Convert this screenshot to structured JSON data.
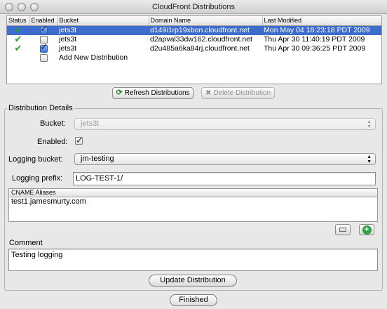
{
  "window": {
    "title": "CloudFront Distributions"
  },
  "table": {
    "columns": [
      "Status",
      "Enabled",
      "Bucket",
      "Domain Name",
      "Last Modified"
    ],
    "rows": [
      {
        "bucket": "jets3t",
        "domain": "d149i1rp19xbon.cloudfront.net",
        "modified": "Mon May 04 18:23:18 PDT 2009",
        "enabled": true,
        "status": "deployed-icon",
        "selected": true
      },
      {
        "bucket": "jets3t",
        "domain": "d2apval33dw162.cloudfront.net",
        "modified": "Thu Apr 30 11:40:19 PDT 2009",
        "enabled": false,
        "status": "deployed-icon",
        "selected": false
      },
      {
        "bucket": "jets3t",
        "domain": "d2u485a6ka84rj.cloudfront.net",
        "modified": "Thu Apr 30 09:36:25 PDT 2009",
        "enabled": true,
        "status": "deployed-icon",
        "selected": false
      }
    ],
    "add_new_label": "Add New Distribution"
  },
  "actions": {
    "refresh_label": "Refresh Distributions",
    "delete_label": "Delete Distribution"
  },
  "details": {
    "group_title": "Distribution Details",
    "bucket_label": "Bucket:",
    "bucket_value": "jets3t",
    "enabled_label": "Enabled:",
    "enabled_value": true,
    "logging_bucket_label": "Logging bucket:",
    "logging_bucket_value": "jm-testing",
    "logging_prefix_label": "Logging prefix:",
    "logging_prefix_value": "LOG-TEST-1/",
    "cname_header": "CNAME Aliases",
    "cname_aliases": [
      "test1.jamesmurty.com"
    ],
    "comment_label": "Comment",
    "comment_value": "Testing logging",
    "update_label": "Update Distribution"
  },
  "footer": {
    "finished_label": "Finished"
  },
  "colors": {
    "selection": "#3d6dcc",
    "status_ok": "#27a02d",
    "add_icon": "#2fa043"
  }
}
